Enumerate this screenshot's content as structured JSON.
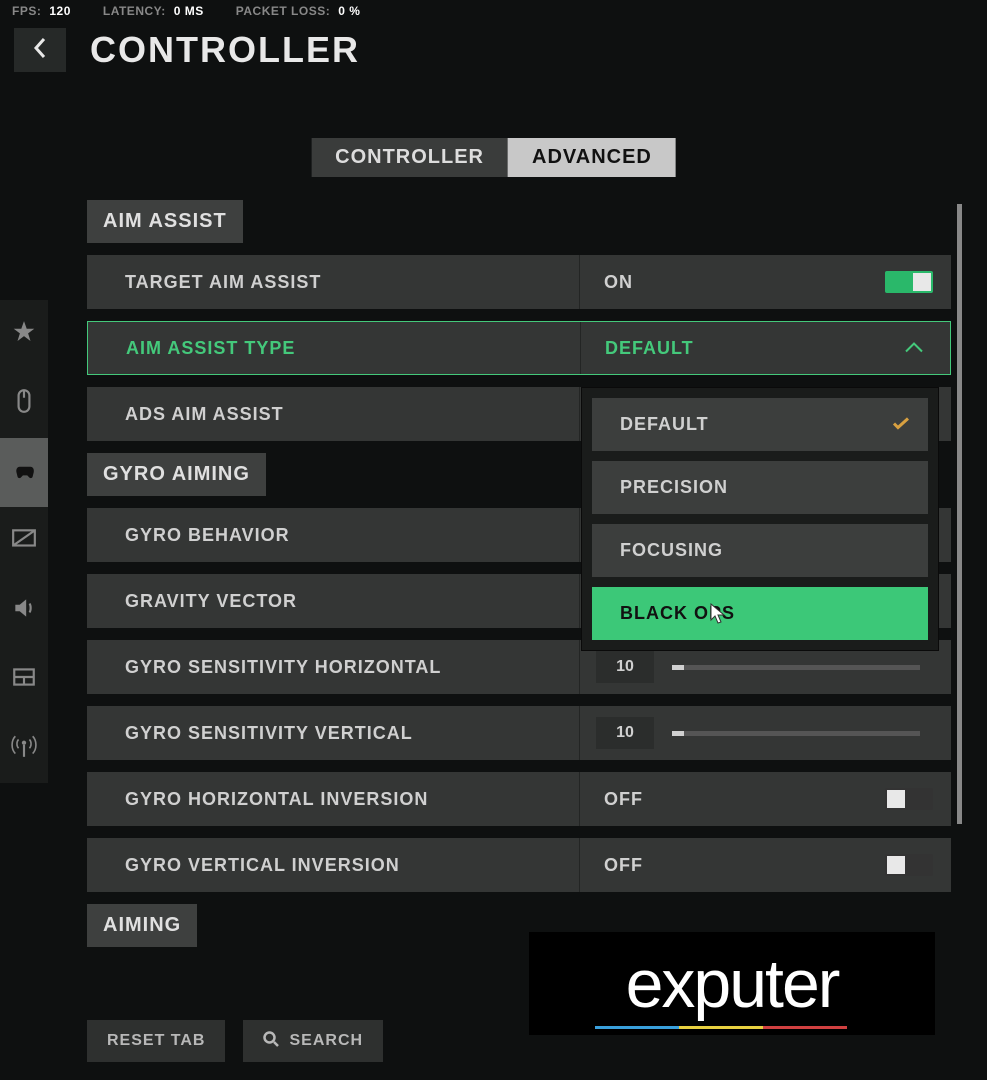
{
  "stats": {
    "fps_label": "FPS:",
    "fps": "120",
    "latency_label": "LATENCY:",
    "latency": "0 MS",
    "loss_label": "PACKET LOSS:",
    "loss": "0 %"
  },
  "page_title": "CONTROLLER",
  "tabs": {
    "controller": "CONTROLLER",
    "advanced": "ADVANCED"
  },
  "sections": {
    "aim_assist": "AIM ASSIST",
    "gyro_aiming": "GYRO AIMING",
    "aiming": "AIMING"
  },
  "settings": {
    "target_aim_assist": {
      "label": "TARGET AIM ASSIST",
      "value": "ON"
    },
    "aim_assist_type": {
      "label": "AIM ASSIST TYPE",
      "value": "DEFAULT"
    },
    "ads_aim_assist": {
      "label": "ADS AIM ASSIST",
      "value": ""
    },
    "gyro_behavior": {
      "label": "GYRO BEHAVIOR",
      "value": ""
    },
    "gravity_vector": {
      "label": "GRAVITY VECTOR",
      "value": ""
    },
    "gyro_sens_h": {
      "label": "GYRO SENSITIVITY HORIZONTAL",
      "value": "10"
    },
    "gyro_sens_v": {
      "label": "GYRO SENSITIVITY VERTICAL",
      "value": "10"
    },
    "gyro_h_inv": {
      "label": "GYRO HORIZONTAL INVERSION",
      "value": "OFF"
    },
    "gyro_v_inv": {
      "label": "GYRO VERTICAL INVERSION",
      "value": "OFF"
    }
  },
  "dropdown": {
    "opt0": "DEFAULT",
    "opt1": "PRECISION",
    "opt2": "FOCUSING",
    "opt3": "BLACK OPS"
  },
  "buttons": {
    "reset": "RESET TAB",
    "search": "SEARCH"
  },
  "watermark": "exputer",
  "colors": {
    "accent_green": "#3cc878",
    "highlight_border": "#44c97b"
  }
}
